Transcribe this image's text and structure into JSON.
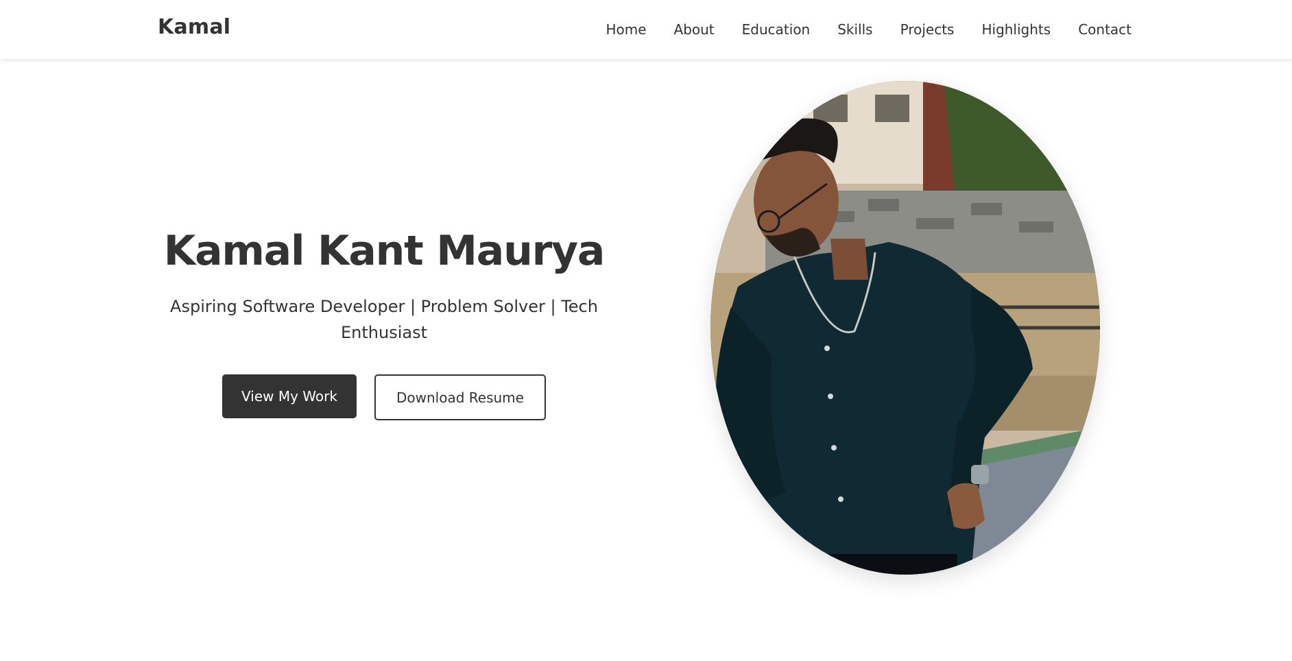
{
  "header": {
    "logo": "Kamal",
    "nav": [
      "Home",
      "About",
      "Education",
      "Skills",
      "Projects",
      "Highlights",
      "Contact"
    ]
  },
  "hero": {
    "title": "Kamal Kant Maurya",
    "subtitle": "Aspiring Software Developer | Problem Solver | Tech Enthusiast",
    "primary_button": "View My Work",
    "secondary_button": "Download Resume"
  },
  "colors": {
    "text": "#333333",
    "primary_bg": "#333333",
    "background": "#ffffff"
  }
}
